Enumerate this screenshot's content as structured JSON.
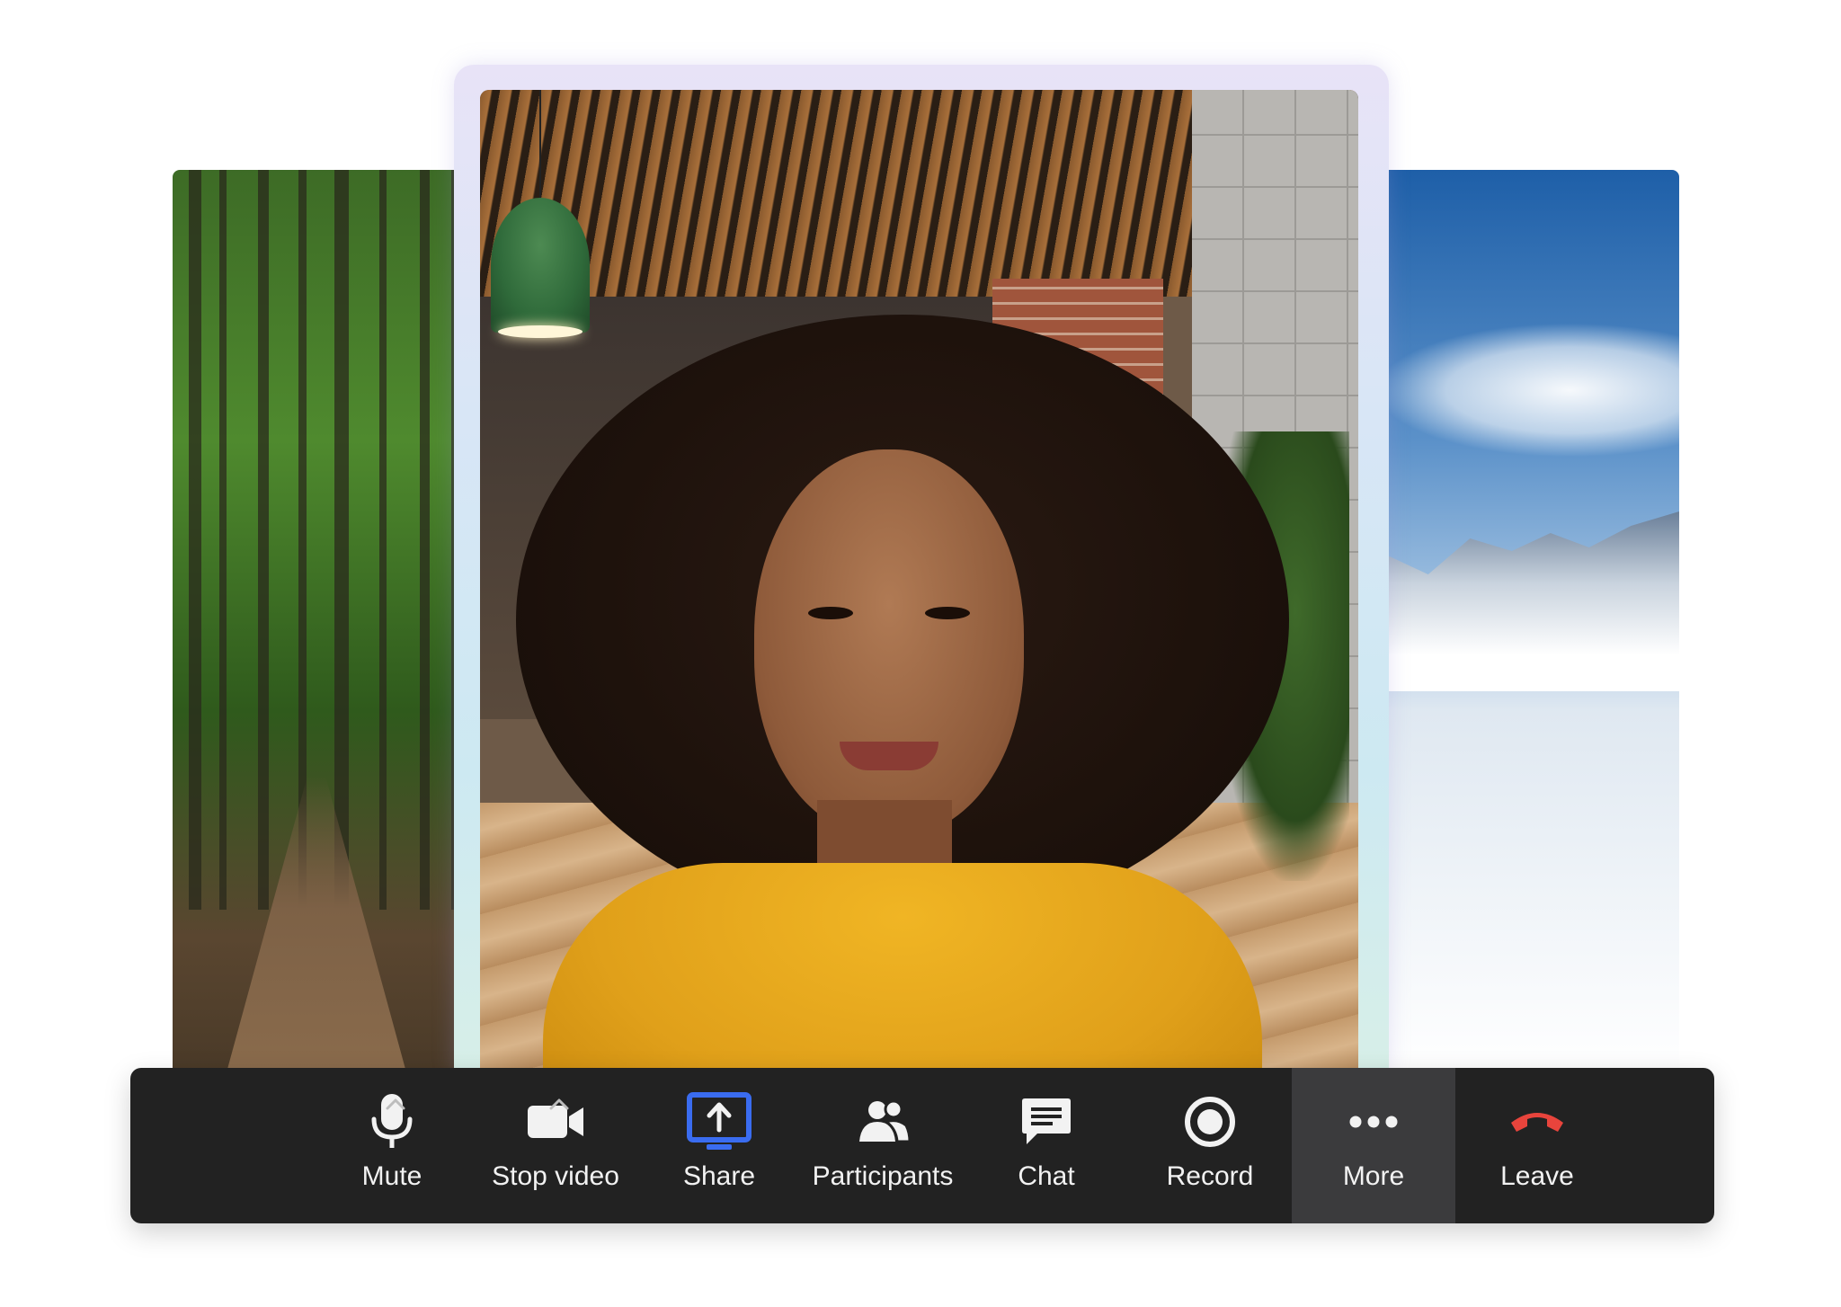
{
  "toolbar": {
    "mute": "Mute",
    "stop_video": "Stop video",
    "share": "Share",
    "participants": "Participants",
    "chat": "Chat",
    "record": "Record",
    "more": "More",
    "leave": "Leave",
    "active_item": "More"
  },
  "colors": {
    "toolbar_bg": "#222222",
    "share_accent": "#3a6cf0",
    "leave_accent": "#e8443c",
    "active_bg": "#3b3b3d"
  },
  "icons": {
    "mute": "microphone-icon",
    "stop_video": "video-camera-icon",
    "share": "share-screen-icon",
    "participants": "participants-icon",
    "chat": "chat-bubble-icon",
    "record": "record-icon",
    "more": "more-dots-icon",
    "leave": "hang-up-phone-icon",
    "caret": "caret-up-icon"
  }
}
